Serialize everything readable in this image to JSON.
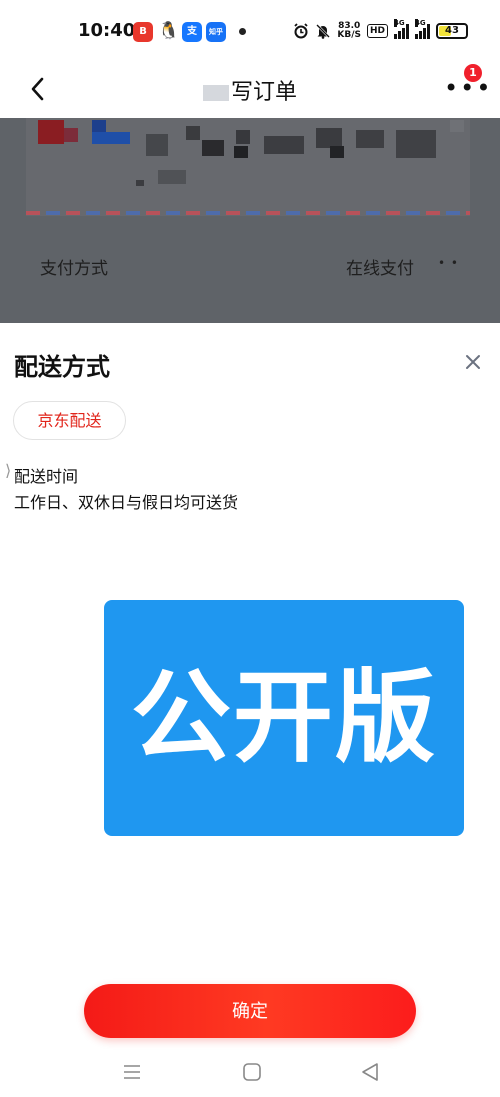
{
  "status_bar": {
    "time": "10:40",
    "app_icons": [
      "bilibili-icon",
      "qq-icon",
      "alipay-icon",
      "zhihu-icon"
    ],
    "app_icon_labels": [
      "B",
      "🐧",
      "支",
      "知乎"
    ],
    "net_speed_value": "83.0",
    "net_speed_unit": "KB/S",
    "hd_label": "HD",
    "signal_1_label": "4G",
    "signal_2_label": "4G",
    "battery_level": "43",
    "battery_fraction": 0.43
  },
  "header": {
    "title": "写订单",
    "notification_count": "1"
  },
  "order": {
    "payment_label": "支付方式",
    "payment_value": "在线支付"
  },
  "sheet": {
    "title": "配送方式",
    "option_label": "京东配送",
    "time_label": "配送时间",
    "time_desc": "工作日、双休日与假日均可送货",
    "watermark": "公开版",
    "confirm_label": "确定"
  },
  "colors": {
    "accent_red": "#e1251b",
    "button_red": "#f41a17",
    "watermark_blue": "#1f97f0",
    "dim_overlay": "#5f6368"
  }
}
